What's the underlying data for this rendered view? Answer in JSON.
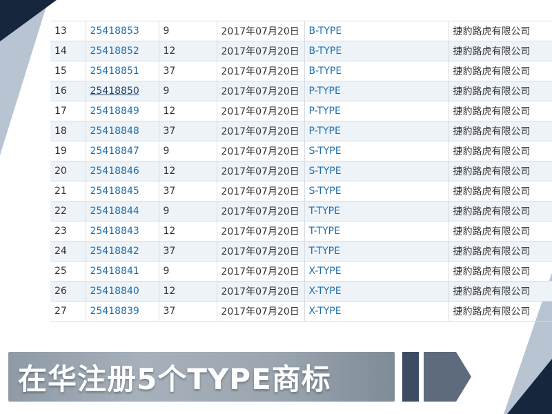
{
  "colors": {
    "navy": "#16263c",
    "slate": "#5d6b7c",
    "light_slate": "#b8c4d2",
    "link": "#1e6fae",
    "row_alt": "#eef3f8"
  },
  "table": {
    "rows": [
      {
        "no": "13",
        "reg": "25418853",
        "cls": "9",
        "date": "2017年07月20日",
        "name": "B-TYPE",
        "owner": "捷豹路虎有限公司"
      },
      {
        "no": "14",
        "reg": "25418852",
        "cls": "12",
        "date": "2017年07月20日",
        "name": "B-TYPE",
        "owner": "捷豹路虎有限公司"
      },
      {
        "no": "15",
        "reg": "25418851",
        "cls": "37",
        "date": "2017年07月20日",
        "name": "B-TYPE",
        "owner": "捷豹路虎有限公司"
      },
      {
        "no": "16",
        "reg": "25418850",
        "cls": "9",
        "date": "2017年07月20日",
        "name": "P-TYPE",
        "owner": "捷豹路虎有限公司"
      },
      {
        "no": "17",
        "reg": "25418849",
        "cls": "12",
        "date": "2017年07月20日",
        "name": "P-TYPE",
        "owner": "捷豹路虎有限公司"
      },
      {
        "no": "18",
        "reg": "25418848",
        "cls": "37",
        "date": "2017年07月20日",
        "name": "P-TYPE",
        "owner": "捷豹路虎有限公司"
      },
      {
        "no": "19",
        "reg": "25418847",
        "cls": "9",
        "date": "2017年07月20日",
        "name": "S-TYPE",
        "owner": "捷豹路虎有限公司"
      },
      {
        "no": "20",
        "reg": "25418846",
        "cls": "12",
        "date": "2017年07月20日",
        "name": "S-TYPE",
        "owner": "捷豹路虎有限公司"
      },
      {
        "no": "21",
        "reg": "25418845",
        "cls": "37",
        "date": "2017年07月20日",
        "name": "S-TYPE",
        "owner": "捷豹路虎有限公司"
      },
      {
        "no": "22",
        "reg": "25418844",
        "cls": "9",
        "date": "2017年07月20日",
        "name": "T-TYPE",
        "owner": "捷豹路虎有限公司"
      },
      {
        "no": "23",
        "reg": "25418843",
        "cls": "12",
        "date": "2017年07月20日",
        "name": "T-TYPE",
        "owner": "捷豹路虎有限公司"
      },
      {
        "no": "24",
        "reg": "25418842",
        "cls": "37",
        "date": "2017年07月20日",
        "name": "T-TYPE",
        "owner": "捷豹路虎有限公司"
      },
      {
        "no": "25",
        "reg": "25418841",
        "cls": "9",
        "date": "2017年07月20日",
        "name": "X-TYPE",
        "owner": "捷豹路虎有限公司"
      },
      {
        "no": "26",
        "reg": "25418840",
        "cls": "12",
        "date": "2017年07月20日",
        "name": "X-TYPE",
        "owner": "捷豹路虎有限公司"
      },
      {
        "no": "27",
        "reg": "25418839",
        "cls": "37",
        "date": "2017年07月20日",
        "name": "X-TYPE",
        "owner": "捷豹路虎有限公司"
      }
    ],
    "underlined_row": "16"
  },
  "banner": {
    "title": "在华注册5个TYPE商标"
  }
}
